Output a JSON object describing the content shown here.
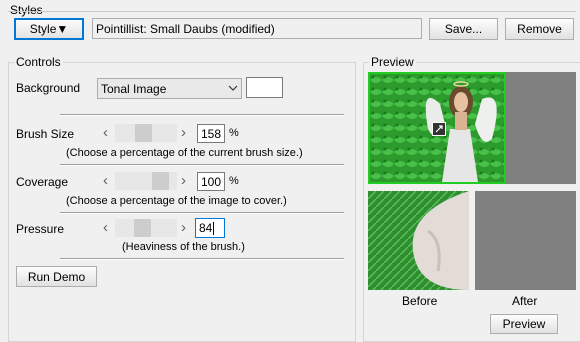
{
  "styles": {
    "group_label": "Styles",
    "style_button_label": "Style▼",
    "style_name": "Pointillist: Small Daubs (modified)",
    "save_label": "Save...",
    "remove_label": "Remove"
  },
  "controls": {
    "group_label": "Controls",
    "background": {
      "label": "Background",
      "value": "Tonal Image",
      "swatch_color": "#ffffff"
    },
    "brush_size": {
      "label": "Brush Size",
      "value": "158",
      "unit": "%",
      "hint": "(Choose a percentage of the current brush size.)",
      "slider_fraction": 0.45
    },
    "coverage": {
      "label": "Coverage",
      "value": "100",
      "unit": "%",
      "hint": "(Choose a percentage of the image to cover.)",
      "slider_fraction": 0.82
    },
    "pressure": {
      "label": "Pressure",
      "value": "84",
      "hint": "(Heaviness of the brush.)",
      "slider_fraction": 0.42
    },
    "run_demo_label": "Run Demo"
  },
  "preview": {
    "group_label": "Preview",
    "before_label": "Before",
    "after_label": "After",
    "preview_button_label": "Preview"
  },
  "icons": {
    "left_arrow": "‹",
    "right_arrow": "›",
    "dropdown": "chevron-down-icon",
    "navigator": "move-icon"
  }
}
